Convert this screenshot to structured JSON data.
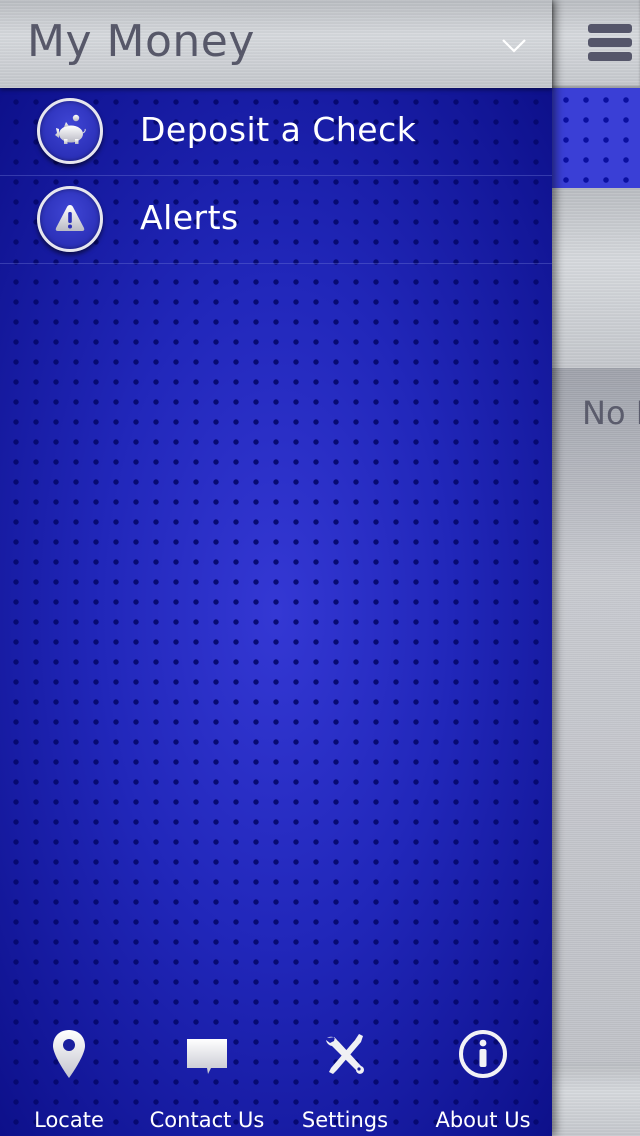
{
  "drawer": {
    "title": "My Money",
    "dropdown_icon": "chevron-down-icon",
    "menu_items": [
      {
        "label": "Deposit a Check",
        "icon": "piggy-bank-icon"
      },
      {
        "label": "Alerts",
        "icon": "warning-icon"
      }
    ],
    "bottom_bar": [
      {
        "label": "Locate",
        "icon": "map-pin-icon"
      },
      {
        "label": "Contact Us",
        "icon": "chat-bubble-icon"
      },
      {
        "label": "Settings",
        "icon": "tools-icon"
      },
      {
        "label": "About Us",
        "icon": "info-icon"
      }
    ]
  },
  "main": {
    "menu_icon": "hamburger-menu-icon",
    "status_text": "No I"
  },
  "colors": {
    "drawer_blue": "#2229b8",
    "header_text": "#575869",
    "menu_text": "#ffffff",
    "main_blue": "#3a3fd6"
  }
}
